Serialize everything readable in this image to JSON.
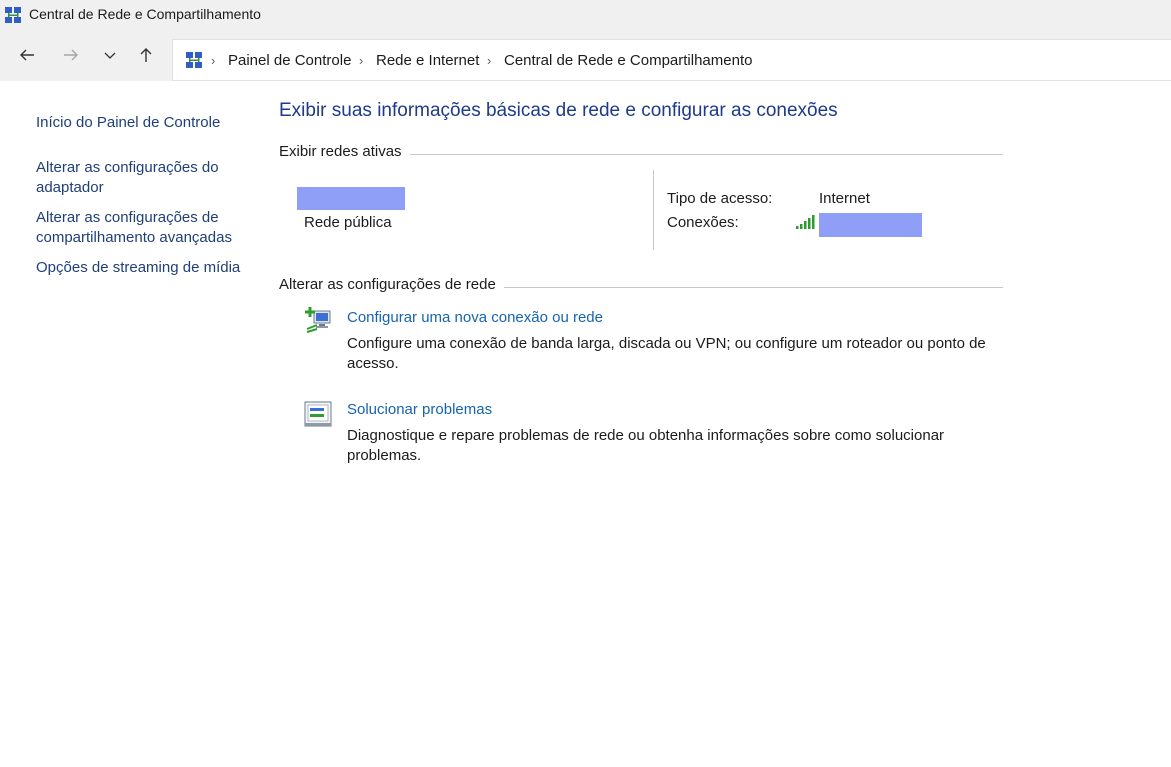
{
  "window": {
    "title": "Central de Rede e Compartilhamento",
    "icon": "network-center-icon"
  },
  "navigation": {
    "back_icon": "arrow-left-icon",
    "forward_icon": "arrow-right-icon",
    "recent_icon": "chevron-down-icon",
    "up_icon": "arrow-up-icon",
    "breadcrumb": [
      "Painel de Controle",
      "Rede e Internet",
      "Central de Rede e Compartilhamento"
    ]
  },
  "sidebar": {
    "items": [
      {
        "label": "Início do Painel de Controle"
      },
      {
        "label": "Alterar as configurações do adaptador"
      },
      {
        "label": "Alterar as configurações de compartilhamento avançadas"
      },
      {
        "label": "Opções de streaming de mídia"
      }
    ]
  },
  "main": {
    "title": "Exibir suas informações básicas de rede e configurar as conexões",
    "active_networks": {
      "heading": "Exibir redes ativas",
      "network_type": "Rede pública",
      "access_type_label": "Tipo de acesso:",
      "access_type_value": "Internet",
      "connections_label": "Conexões:",
      "connection_icon": "wifi-signal-icon"
    },
    "change_settings": {
      "heading": "Alterar as configurações de rede",
      "tasks": [
        {
          "icon": "new-connection-icon",
          "label": "Configurar uma nova conexão ou rede",
          "description": "Configure uma conexão de banda larga, discada ou VPN; ou configure um roteador ou ponto de acesso."
        },
        {
          "icon": "troubleshoot-icon",
          "label": "Solucionar problemas",
          "description": "Diagnostique e repare problemas de rede ou obtenha informações sobre como solucionar problemas."
        }
      ]
    }
  },
  "colors": {
    "title_blue": "#1e3a8a",
    "link_blue": "#1664b0",
    "redaction": "#8f9ff7",
    "chrome_gray": "#f0f0f0"
  }
}
